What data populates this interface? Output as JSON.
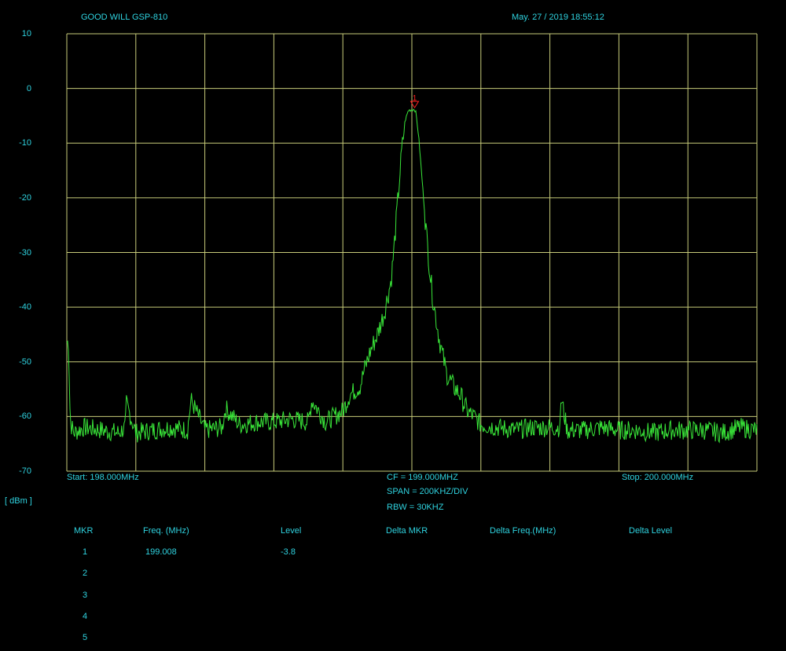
{
  "header": {
    "instrument": "GOOD WILL GSP-810",
    "timestamp": "May. 27 / 2019  18:55:12"
  },
  "colors": {
    "background": "#000000",
    "grid": "#c8cc7a",
    "trace": "#39e639",
    "text": "#2fd3e0",
    "marker": "#ff2020"
  },
  "axis": {
    "unit_label": "[ dBm ]",
    "y_ticks": [
      "10",
      "0",
      "-10",
      "-20",
      "-30",
      "-40",
      "-50",
      "-60",
      "-70"
    ],
    "start_label": "Start:  198.000MHz",
    "stop_label": "Stop:  200.000MHz",
    "cf_label": "CF = 199.000MHZ",
    "span_label": "SPAN = 200KHZ/DIV",
    "rbw_label": "RBW = 30KHZ"
  },
  "marker_table": {
    "headers": [
      "MKR",
      "Freq. (MHz)",
      "Level",
      "Delta MKR",
      "Delta Freq.(MHz)",
      "Delta Level"
    ],
    "rows": [
      {
        "mkr": "1",
        "freq": "199.008",
        "level": "-3.8",
        "delta_mkr": "",
        "delta_freq": "",
        "delta_level": ""
      },
      {
        "mkr": "2",
        "freq": "",
        "level": "",
        "delta_mkr": "",
        "delta_freq": "",
        "delta_level": ""
      },
      {
        "mkr": "3",
        "freq": "",
        "level": "",
        "delta_mkr": "",
        "delta_freq": "",
        "delta_level": ""
      },
      {
        "mkr": "4",
        "freq": "",
        "level": "",
        "delta_mkr": "",
        "delta_freq": "",
        "delta_level": ""
      },
      {
        "mkr": "5",
        "freq": "",
        "level": "",
        "delta_mkr": "",
        "delta_freq": "",
        "delta_level": ""
      }
    ]
  },
  "chart_data": {
    "type": "line",
    "xlabel": "",
    "ylabel": "[ dBm ]",
    "xlim": [
      198.0,
      200.0
    ],
    "ylim": [
      -70,
      10
    ],
    "x_units": "MHz",
    "grid": true,
    "x_divisions": 10,
    "y_divisions": 8,
    "series": [
      {
        "x": [
          198.0,
          198.005,
          198.01,
          198.02,
          198.05,
          198.1,
          198.15,
          198.17,
          198.172,
          198.2,
          198.25,
          198.3,
          198.35,
          198.36,
          198.4,
          198.45,
          198.46,
          198.5,
          198.55,
          198.6,
          198.65,
          198.7,
          198.71,
          198.75,
          198.8,
          198.82,
          198.85,
          198.86,
          198.88,
          198.9,
          198.92,
          198.94,
          198.95,
          198.96,
          198.97,
          198.98,
          198.99,
          199.0,
          199.005,
          199.008,
          199.012,
          199.02,
          199.03,
          199.04,
          199.05,
          199.06,
          199.07,
          199.08,
          199.09,
          199.1,
          199.12,
          199.14,
          199.16,
          199.18,
          199.2,
          199.25,
          199.3,
          199.35,
          199.4,
          199.43,
          199.432,
          199.45,
          199.5,
          199.55,
          199.6,
          199.65,
          199.7,
          199.75,
          199.8,
          199.85,
          199.9,
          199.95,
          200.0
        ],
        "y": [
          -46.5,
          -46.5,
          -61.0,
          -63.0,
          -62.0,
          -62.5,
          -63.0,
          -62.0,
          -57.5,
          -63.0,
          -62.5,
          -62.0,
          -62.5,
          -57.0,
          -62.5,
          -62.0,
          -58.5,
          -61.5,
          -61.0,
          -61.0,
          -60.5,
          -61.0,
          -57.0,
          -61.0,
          -59.0,
          -56.0,
          -54.5,
          -52.0,
          -48.0,
          -45.0,
          -41.0,
          -35.0,
          -28.0,
          -20.0,
          -12.0,
          -6.0,
          -4.0,
          -3.9,
          -3.8,
          -3.8,
          -4.5,
          -9.0,
          -17.0,
          -25.0,
          -32.0,
          -38.0,
          -42.0,
          -46.0,
          -49.0,
          -52.0,
          -54.5,
          -56.0,
          -59.0,
          -60.0,
          -61.5,
          -62.0,
          -62.5,
          -62.0,
          -62.0,
          -62.0,
          -56.5,
          -62.5,
          -62.5,
          -62.0,
          -62.5,
          -62.5,
          -63.0,
          -62.5,
          -62.5,
          -62.5,
          -63.0,
          -62.0,
          -62.5
        ]
      }
    ],
    "markers": [
      {
        "label": "1",
        "x": 199.008,
        "y": -3.8
      }
    ]
  }
}
